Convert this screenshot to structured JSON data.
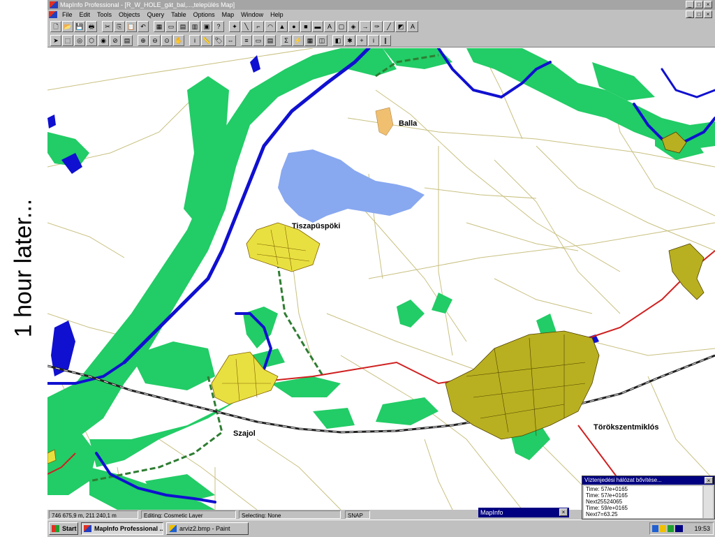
{
  "annotation": "1 hour later...",
  "window": {
    "title": "MapInfo Professional - [R_W_HOLE_gát_bal,...,település Map]",
    "controls": [
      "_",
      "□",
      "×"
    ]
  },
  "menu": [
    "File",
    "Edit",
    "Tools",
    "Objects",
    "Query",
    "Table",
    "Options",
    "Map",
    "Window",
    "Help"
  ],
  "toolbar_main": [
    "new-icon",
    "open-icon",
    "save-icon",
    "print-icon",
    "cut-icon",
    "copy-icon",
    "paste-icon",
    "undo-icon",
    "browser-icon",
    "map-icon",
    "graph-icon",
    "layout-icon",
    "redistrict-icon",
    "help-icon",
    "symbol-icon",
    "line-icon",
    "polyline-icon",
    "arc-icon",
    "polygon-icon",
    "ellipse-icon",
    "rectangle-icon",
    "rounded-rect-icon",
    "text-icon",
    "frame-icon",
    "reshape-icon",
    "add-node-icon",
    "symbol-style-icon",
    "line-style-icon",
    "region-style-icon",
    "text-style-icon"
  ],
  "toolbar_main_glyphs": [
    "🗋",
    "📂",
    "💾",
    "🖶",
    "✂",
    "⎘",
    "📋",
    "↶",
    "▦",
    "▭",
    "▤",
    "▥",
    "▣",
    "?",
    "✦",
    "╲",
    "⌐",
    "◠",
    "▲",
    "●",
    "■",
    "▬",
    "A",
    "▢",
    "◈",
    "→",
    "✑",
    "╱",
    "◩",
    "A"
  ],
  "toolbar_main_glyph_labels": [
    "",
    "",
    "",
    "",
    "",
    "",
    "",
    "",
    "",
    "",
    "",
    "",
    "",
    "",
    "",
    "",
    "",
    "",
    "",
    "",
    "",
    "",
    "A",
    "",
    "",
    "",
    "",
    "",
    "",
    "A"
  ],
  "toolbar_tools": [
    "select-icon",
    "marquee-icon",
    "radius-icon",
    "polygon-select-icon",
    "boundary-icon",
    "unselect-icon",
    "invert-icon",
    "zoom-in-icon",
    "zoom-out-icon",
    "change-view-icon",
    "grabber-icon",
    "info-icon",
    "ruler-icon",
    "label-icon",
    "drag-icon",
    "layer-control-icon",
    "legend-icon",
    "statistics-icon",
    "sum-icon",
    "hotlink-icon",
    "thematic-icon",
    "clip-icon",
    "show-icon",
    "pin-icon",
    "plus-icon",
    "info-i-icon",
    "pause-icon"
  ],
  "toolbar_tools_glyphs": [
    "➤",
    "⬚",
    "◎",
    "⬡",
    "◉",
    "⊘",
    "▤",
    "⊕",
    "⊖",
    "⊙",
    "✋",
    "i",
    "📏",
    "🏷",
    "⇔",
    "≡",
    "▭",
    "▤",
    "Σ",
    "⚡",
    "▦",
    "◫",
    "◧",
    "✱",
    "+",
    "i",
    "∥"
  ],
  "status": {
    "coords": "746 675,9 m, 211 240,1 m",
    "editing": "Editing: Cosmetic Layer",
    "selecting": "Selecting: None",
    "snap": "SNAP"
  },
  "mapinfo_float": "MapInfo",
  "progress_window": {
    "title": "Víztenjedési hálózat bővítése...",
    "lines": [
      "Time: 57/e+0165",
      "Time: 57/e+0165",
      "Next25524065",
      "Time: 59/e+0165",
      "Next7=63.25"
    ]
  },
  "taskbar": {
    "start": "Start",
    "items": [
      {
        "label": "MapInfo Professional ...",
        "active": true
      },
      {
        "label": "arviz2.bmp - Paint",
        "active": false
      }
    ],
    "clock": "19:53"
  },
  "map_labels": [
    {
      "text": "Balla"
    },
    {
      "text": "Tiszapüspöki"
    },
    {
      "text": "Szajol"
    },
    {
      "text": "Törökszentmiklós"
    }
  ],
  "colors": {
    "floodplain": "#22cc66",
    "river": "#1010d0",
    "settlement": "#e8e040",
    "settlement_large": "#b8b020",
    "inundation": "#88a8f0",
    "railway": "#202020",
    "road": "#d02020",
    "parcel_lines": "#c8c080",
    "dike": "#2e7d32",
    "balla": "#f0c070"
  }
}
